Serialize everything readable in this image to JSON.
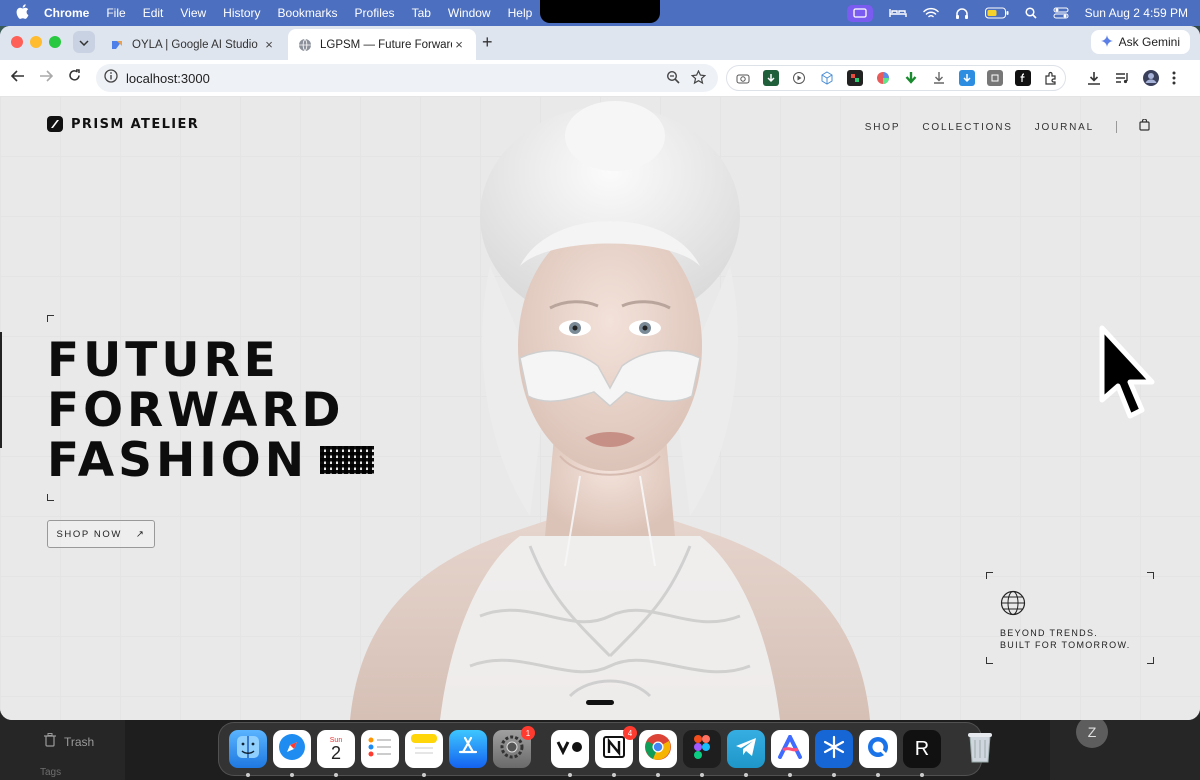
{
  "menubar": {
    "app": "Chrome",
    "items": [
      "File",
      "Edit",
      "View",
      "History",
      "Bookmarks",
      "Profiles",
      "Tab",
      "Window",
      "Help"
    ],
    "clock": "Sun Aug 2  4:59 PM"
  },
  "browser": {
    "tabs": [
      {
        "title": "OYLA | Google AI Studio"
      },
      {
        "title": "LGPSM — Future Forward Fas"
      }
    ],
    "gemini_label": "Ask Gemini",
    "url": "localhost:3000"
  },
  "site": {
    "brand": "PRISM ATELIER",
    "nav": [
      "SHOP",
      "COLLECTIONS",
      "JOURNAL"
    ],
    "hero_lines": [
      "FUTURE",
      "FORWARD",
      "FASHION"
    ],
    "cta_label": "SHOP NOW",
    "cta_arrow": "↗",
    "tagline_1": "BEYOND TRENDS.",
    "tagline_2": "BUILT FOR TOMORROW."
  },
  "desktop": {
    "trash_label": "Trash",
    "tags_label": "Tags",
    "zoom_chip": "Z"
  },
  "dock": {
    "calendar_month": "Sun",
    "calendar_day": "2",
    "settings_badge": "1",
    "notion_badge": "4",
    "last_app_letter": "R"
  },
  "colors": {
    "menubar": "#4d6fbf",
    "page_bg": "#e9e9ea",
    "text_dark": "#0d0d0d"
  }
}
